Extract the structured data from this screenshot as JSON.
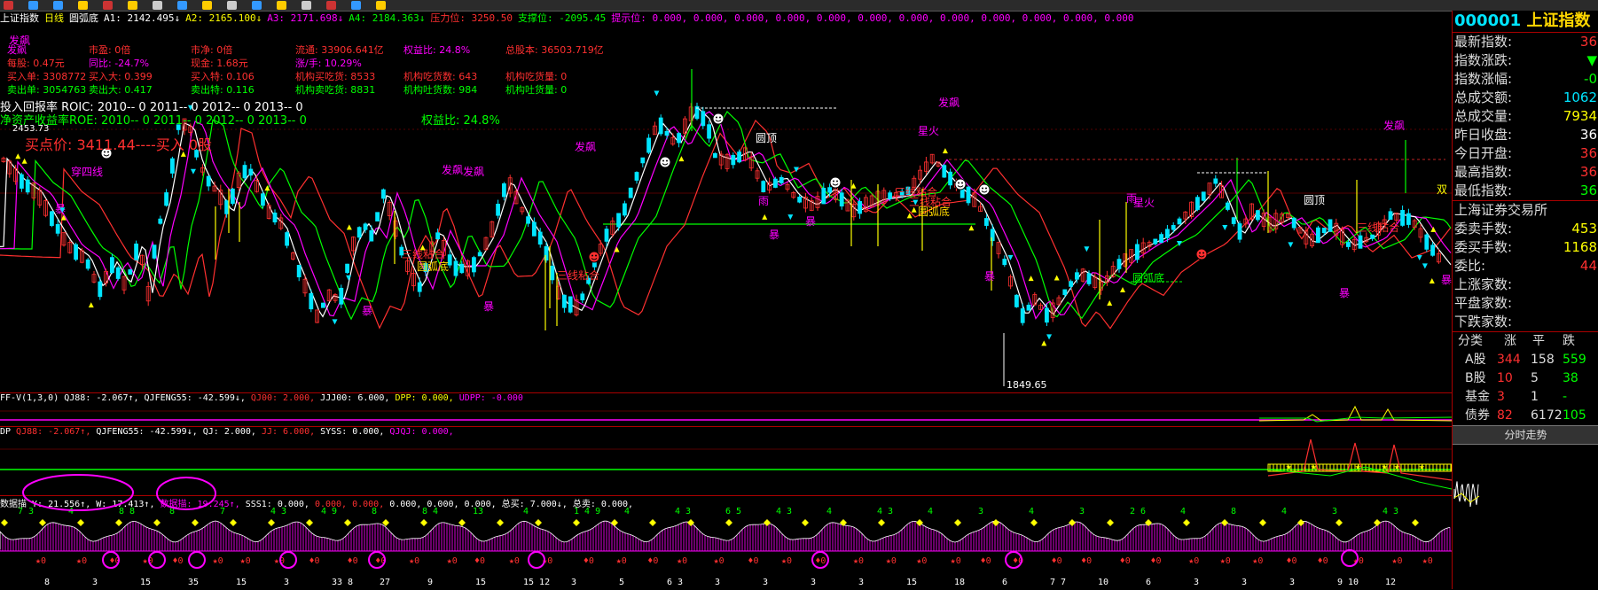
{
  "colors": {
    "red": "#ff3030",
    "green": "#00ff00",
    "yellow": "#ffff00",
    "magenta": "#ff00ff",
    "cyan": "#00e5ff",
    "white": "#ffffff",
    "gold": "#ffd700",
    "pink": "#ff66ff",
    "teal": "#00c8ff"
  },
  "toolbar": {
    "icons": [
      "menu-icon",
      "back-icon",
      "forward-icon",
      "crosshair-icon",
      "draw-icon",
      "chart-icon",
      "window-icon",
      "tile-icon",
      "zoom-icon",
      "print-icon",
      "save-icon",
      "arrow-icon",
      "book-icon",
      "line-icon",
      "bar-icon",
      "help-icon"
    ]
  },
  "infobar": {
    "items": [
      {
        "text": "上证指数",
        "color": "#ffffff"
      },
      {
        "text": "日线",
        "color": "#ffff00"
      },
      {
        "text": "圆弧底",
        "color": "#ffffff"
      },
      {
        "text": "A1: 2142.495↓",
        "color": "#ffffff"
      },
      {
        "text": "A2: 2165.100↓",
        "color": "#ffff00"
      },
      {
        "text": "A3: 2171.698↓",
        "color": "#ff00ff"
      },
      {
        "text": "A4: 2184.363↓",
        "color": "#00ff00"
      },
      {
        "text": "压力位: 3250.50",
        "color": "#ff3030"
      },
      {
        "text": "支撑位: -2095.45",
        "color": "#00ff00"
      },
      {
        "text": "提示位: 0.000, 0.000, 0.000, 0.000, 0.000, 0.000, 0.000, 0.000, 0.000, 0.000, 0.000, 0.000",
        "color": "#ff00ff"
      }
    ]
  },
  "fundamentals": {
    "rows": [
      [
        {
          "t": "发飙",
          "c": "#ff00ff"
        },
        {
          "t": "市盈: 0倍",
          "c": "#ff3030"
        },
        {
          "t": "市净: 0倍",
          "c": "#ff3030"
        },
        {
          "t": "流通: 33906.641亿",
          "c": "#ff3030"
        },
        {
          "t": "权益比: 24.8%",
          "c": "#ff00ff"
        },
        {
          "t": "总股本: 36503.719亿",
          "c": "#ff3030"
        }
      ],
      [
        {
          "t": "每股: 0.47元",
          "c": "#ff3030"
        },
        {
          "t": "同比: -24.7%",
          "c": "#ff00ff"
        },
        {
          "t": "现金: 1.68元",
          "c": "#ff3030"
        },
        {
          "t": "涨/手: 10.29%",
          "c": "#ff00ff"
        }
      ],
      [
        {
          "t": "买入单: 3308772",
          "c": "#ff3030"
        },
        {
          "t": "买入大: 0.399",
          "c": "#ff3030"
        },
        {
          "t": "买入特: 0.106",
          "c": "#ff3030"
        },
        {
          "t": "机构买吃货: 8533",
          "c": "#ff3030"
        },
        {
          "t": "机构吃货数: 643",
          "c": "#ff3030"
        },
        {
          "t": "机构吃货量: 0",
          "c": "#ff3030"
        }
      ],
      [
        {
          "t": "卖出单: 3054763",
          "c": "#00ff00"
        },
        {
          "t": "卖出大: 0.417",
          "c": "#00ff00"
        },
        {
          "t": "卖出特: 0.116",
          "c": "#00ff00"
        },
        {
          "t": "机构卖吃货: 8831",
          "c": "#00ff00"
        },
        {
          "t": "机构吐货数: 984",
          "c": "#00ff00"
        },
        {
          "t": "机构吐货量: 0",
          "c": "#00ff00"
        }
      ]
    ],
    "roic": "投入回报率 ROIC: 2010-- 0    2011-- 0    2012-- 0    2013-- 0",
    "roe": "净资产收益率ROE: 2010-- 0    2011-- 0    2012-- 0    2013-- 0",
    "equity": "权益比: 24.8%",
    "top_label": "2453.73",
    "buypoint": "买点价: 3411.44----买入 0股",
    "low_label": "1849.65"
  },
  "annotations": [
    {
      "t": "穿四线",
      "c": "#ff00ff"
    },
    {
      "t": "发飙",
      "c": "#ff00ff"
    },
    {
      "t": "发飙",
      "c": "#ff00ff"
    },
    {
      "t": "发飙",
      "c": "#ff00ff"
    },
    {
      "t": "发飙",
      "c": "#ff00ff"
    },
    {
      "t": "发飙",
      "c": "#ff00ff"
    },
    {
      "t": "发飙",
      "c": "#ff00ff"
    },
    {
      "t": "圆顶",
      "c": "#ffffff"
    },
    {
      "t": "圆顶",
      "c": "#ffffff"
    },
    {
      "t": "星火",
      "c": "#ff00ff"
    },
    {
      "t": "星火",
      "c": "#ff00ff"
    },
    {
      "t": "三线粘合",
      "c": "#ff3030"
    },
    {
      "t": "三线粘合",
      "c": "#ff3030"
    },
    {
      "t": "三线粘合",
      "c": "#ff3030"
    },
    {
      "t": "三线粘合",
      "c": "#ff3030"
    },
    {
      "t": "三线粘合",
      "c": "#ff3030"
    },
    {
      "t": "圆弧底",
      "c": "#ffd700"
    },
    {
      "t": "圆弧底",
      "c": "#ffd700"
    },
    {
      "t": "圆弧底",
      "c": "#00ff00"
    },
    {
      "t": "双",
      "c": "#ffff00"
    },
    {
      "t": "暴",
      "c": "#ff00ff"
    },
    {
      "t": "暴",
      "c": "#ff00ff"
    },
    {
      "t": "暴",
      "c": "#ff00ff"
    },
    {
      "t": "暴",
      "c": "#ff00ff"
    },
    {
      "t": "暴",
      "c": "#ff00ff"
    },
    {
      "t": "暴",
      "c": "#ff00ff"
    },
    {
      "t": "暴",
      "c": "#ff00ff"
    },
    {
      "t": "暴",
      "c": "#ff00ff"
    },
    {
      "t": "雨",
      "c": "#ff00ff"
    },
    {
      "t": "雨",
      "c": "#ff00ff"
    }
  ],
  "sub1": {
    "items": [
      {
        "t": "FF-V(1,3,0)",
        "c": "#ffffff"
      },
      {
        "t": "QJ88: -2.067↑,",
        "c": "#ffffff"
      },
      {
        "t": "QJFENG55: -42.599↓,",
        "c": "#ffffff"
      },
      {
        "t": "QJ00: 2.000,",
        "c": "#ff3030"
      },
      {
        "t": "JJJ00: 6.000,",
        "c": "#ffffff"
      },
      {
        "t": "DPP: 0.000,",
        "c": "#ffff00"
      },
      {
        "t": "UDPP: -0.000",
        "c": "#ff00ff"
      }
    ]
  },
  "sub2": {
    "items": [
      {
        "t": "DP",
        "c": "#ffffff"
      },
      {
        "t": "QJ88: -2.067↑,",
        "c": "#ff3030"
      },
      {
        "t": "QJFENG55: -42.599↓,",
        "c": "#ffffff"
      },
      {
        "t": "QJ: 2.000,",
        "c": "#ffffff"
      },
      {
        "t": "JJ: 6.000,",
        "c": "#ff3030"
      },
      {
        "t": "SYSS: 0.000,",
        "c": "#ffffff"
      },
      {
        "t": "QJQJ: 0.000,",
        "c": "#ff00ff"
      }
    ]
  },
  "sub3": {
    "items": [
      {
        "t": "数据描 Y: 21.556↑,",
        "c": "#ffffff"
      },
      {
        "t": "W: 17.413↑,",
        "c": "#ffffff"
      },
      {
        "t": "数据描: 19.245↑,",
        "c": "#ff00ff"
      },
      {
        "t": "SSS1: 0.000,",
        "c": "#ffffff"
      },
      {
        "t": "0.000, 0.000,",
        "c": "#ff3030"
      },
      {
        "t": "0.000, 0.000, 0.000,",
        "c": "#ffffff"
      },
      {
        "t": "总买: 7.000↓,",
        "c": "#ffffff"
      },
      {
        "t": "总卖: 0.000,",
        "c": "#ffffff"
      }
    ]
  },
  "sub3_numbers_top": [
    "7 3",
    "4",
    "8 8",
    "8",
    "7",
    "4 3",
    "4 9",
    "8",
    "8 4",
    "13",
    "4",
    "1 4 9",
    "4",
    "4 3",
    "6 5",
    "4 3",
    "4",
    "4 3",
    "4",
    "3",
    "4",
    "3",
    "2 6",
    "4",
    "8",
    "4",
    "3",
    "4 3"
  ],
  "sub3_numbers_bottom": [
    "8",
    "3",
    "15",
    "35",
    "15",
    "3",
    "33 8",
    "27",
    "9",
    "15",
    "15 12",
    "3",
    "5",
    "6 3",
    "3",
    "3",
    "3",
    "3",
    "15",
    "18",
    "6",
    "7 7",
    "10",
    "6",
    "3",
    "3",
    "3",
    "9 10",
    "12"
  ],
  "quote": {
    "code": "000001",
    "name": "上证指数",
    "rows": [
      {
        "k": "最新指数:",
        "v": "36",
        "c": "#ff3030"
      },
      {
        "k": "指数涨跌:",
        "v": "▼",
        "c": "#00ff00"
      },
      {
        "k": "指数涨幅:",
        "v": "-0",
        "c": "#00ff00"
      },
      {
        "k": "总成交额:",
        "v": "1062",
        "c": "#00e5ff"
      },
      {
        "k": "总成交量:",
        "v": "7934",
        "c": "#ffff00"
      },
      {
        "k": "昨日收盘:",
        "v": "36",
        "c": "#ffffff"
      },
      {
        "k": "今日开盘:",
        "v": "36",
        "c": "#ff3030"
      },
      {
        "k": "最高指数:",
        "v": "36",
        "c": "#ff3030"
      },
      {
        "k": "最低指数:",
        "v": "36",
        "c": "#00ff00"
      }
    ],
    "exchange": "上海证券交易所",
    "rows2": [
      {
        "k": "委卖手数:",
        "v": "453",
        "c": "#ffff00"
      },
      {
        "k": "委买手数:",
        "v": "1168",
        "c": "#ffff00"
      },
      {
        "k": "委比:",
        "v": "44",
        "c": "#ff3030"
      },
      {
        "k": "上涨家数:",
        "v": "",
        "c": "#ff3030"
      },
      {
        "k": "平盘家数:",
        "v": "",
        "c": "#ffffff"
      },
      {
        "k": "下跌家数:",
        "v": "",
        "c": "#00ff00"
      }
    ],
    "cat_head": [
      "分类",
      "涨",
      "平",
      "跌"
    ],
    "cats": [
      {
        "n": "A股",
        "u": "344",
        "f": "158",
        "d": "559"
      },
      {
        "n": "B股",
        "u": "10",
        "f": "5",
        "d": "38"
      },
      {
        "n": "基金",
        "u": "3",
        "f": "1",
        "d": "-"
      },
      {
        "n": "债券",
        "u": "82",
        "f": "6172",
        "d": "105"
      }
    ],
    "tab": "分时走势"
  }
}
